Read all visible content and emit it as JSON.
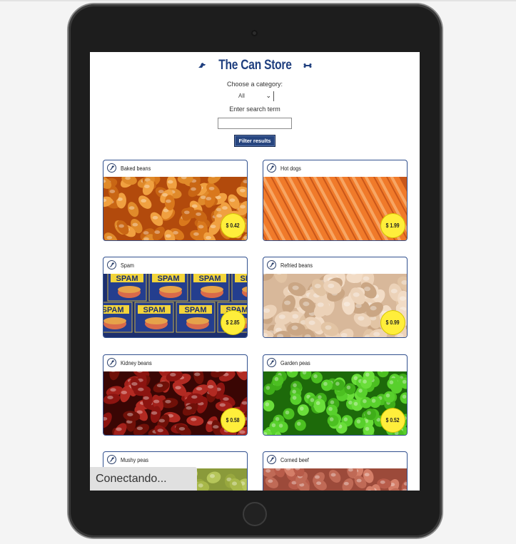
{
  "header": {
    "title": "The Can Store"
  },
  "controls": {
    "category_label": "Choose a category:",
    "category_value": "All",
    "search_label": "Enter search term",
    "search_value": "",
    "filter_label": "Filter results"
  },
  "products": [
    {
      "name": "Baked beans",
      "price": "$ 0.42",
      "image": "baked-beans"
    },
    {
      "name": "Hot dogs",
      "price": "$ 1.99",
      "image": "hot-dogs"
    },
    {
      "name": "Spam",
      "price": "$ 2.85",
      "image": "spam"
    },
    {
      "name": "Refried beans",
      "price": "$ 0.99",
      "image": "refried-beans"
    },
    {
      "name": "Kidney beans",
      "price": "$ 0.58",
      "image": "kidney-beans"
    },
    {
      "name": "Garden peas",
      "price": "$ 0.52",
      "image": "garden-peas"
    },
    {
      "name": "Mushy peas",
      "price": "",
      "image": "mushy-peas"
    },
    {
      "name": "Corned beef",
      "price": "",
      "image": "corned-beef"
    }
  ],
  "status": {
    "text": "Conectando..."
  },
  "colors": {
    "accent": "#1f3f7f",
    "price_badge": "#ffee3b",
    "button": "#27457f"
  }
}
